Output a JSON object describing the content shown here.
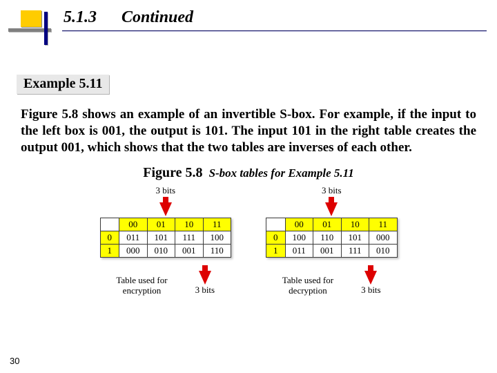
{
  "section_number": "5.1.3",
  "section_title": "Continued",
  "example_label": "Example 5.11",
  "body_text": "Figure 5.8 shows an example of an invertible S-box. For example, if the input to the left box is 001, the output is 101. The input 101 in the right table creates the output 001, which shows that the two tables are inverses of each other.",
  "figure_number": "Figure 5.8",
  "figure_desc": "S-box tables for Example 5.11",
  "bits_label": "3 bits",
  "left_caption": "Table used for\nencryption",
  "right_caption": "Table used for\ndecryption",
  "page_number": "30",
  "chart_data": {
    "type": "table",
    "tables": [
      {
        "name": "encryption",
        "col_headers": [
          "00",
          "01",
          "10",
          "11"
        ],
        "row_headers": [
          "0",
          "1"
        ],
        "rows": [
          [
            "011",
            "101",
            "111",
            "100"
          ],
          [
            "000",
            "010",
            "001",
            "110"
          ]
        ]
      },
      {
        "name": "decryption",
        "col_headers": [
          "00",
          "01",
          "10",
          "11"
        ],
        "row_headers": [
          "0",
          "1"
        ],
        "rows": [
          [
            "100",
            "110",
            "101",
            "000"
          ],
          [
            "011",
            "001",
            "111",
            "010"
          ]
        ]
      }
    ]
  }
}
